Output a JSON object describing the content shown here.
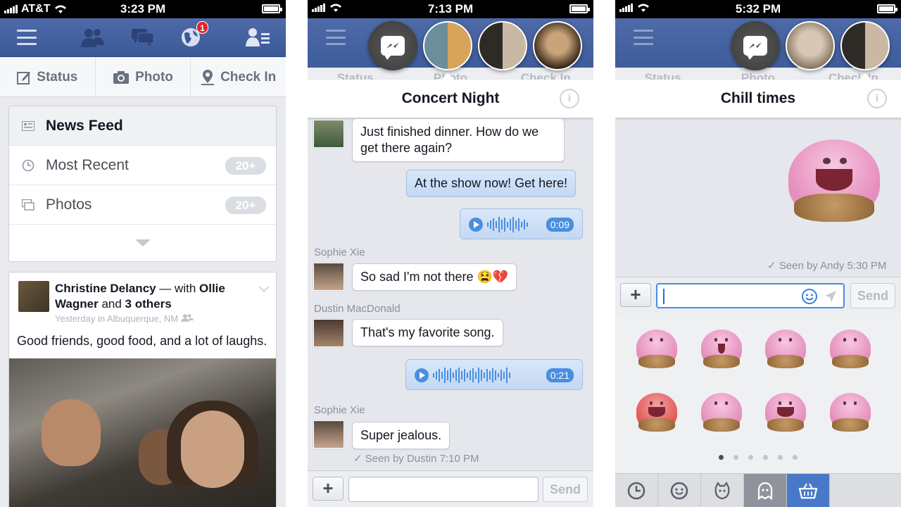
{
  "colors": {
    "brand": "#3b5998",
    "badge": "#e52228",
    "bubble_out": "#c3d8f3",
    "audio": "#4a8ee0"
  },
  "screen1": {
    "status": {
      "carrier": "AT&T",
      "time": "3:23 PM"
    },
    "nav": {
      "icons": [
        "menu-icon",
        "friends-icon",
        "messages-icon",
        "notifications-icon",
        "friend-requests-icon"
      ],
      "notification_count": "1"
    },
    "actions": [
      {
        "label": "Status",
        "icon": "edit-icon"
      },
      {
        "label": "Photo",
        "icon": "camera-icon"
      },
      {
        "label": "Check In",
        "icon": "location-icon"
      }
    ],
    "menu": [
      {
        "label": "News Feed",
        "icon": "feed-icon",
        "count": ""
      },
      {
        "label": "Most Recent",
        "icon": "clock-icon",
        "count": "20+"
      },
      {
        "label": "Photos",
        "icon": "photos-icon",
        "count": "20+"
      }
    ],
    "post": {
      "author": "Christine Delancy",
      "with": " — with ",
      "tag1": "Ollie Wagner",
      "and": " and ",
      "tag2": "3 others",
      "meta": "Yesterday in Albuquerque, NM",
      "text": "Good friends, good food, and a lot of laughs."
    }
  },
  "screen2": {
    "status": {
      "time": "7:13 PM"
    },
    "title": "Concert Night",
    "ghost": {
      "status": "Status",
      "photo": "Photo",
      "checkin": "Check In"
    },
    "messages": [
      {
        "text": "Just finished dinner.  How do we get there again?"
      },
      {
        "text": "At the show now! Get here!"
      },
      {
        "duration": "0:09"
      },
      {
        "sender": "Sophie Xie",
        "text": "So sad I'm not there 😫💔"
      },
      {
        "sender": "Dustin MacDonald",
        "text": "That's my favorite song."
      },
      {
        "duration": "0:21"
      },
      {
        "sender": "Sophie Xie",
        "text": "Super jealous."
      }
    ],
    "seen": "Seen by Dustin 7:10 PM",
    "input": {
      "plus": "+",
      "send": "Send",
      "placeholder": ""
    }
  },
  "screen3": {
    "status": {
      "time": "5:32 PM"
    },
    "title": "Chill times",
    "ghost": {
      "status": "Status",
      "photo": "Photo",
      "checkin": "Check In"
    },
    "seen": "Seen by Andy 5:30 PM",
    "input": {
      "plus": "+",
      "send": "Send"
    },
    "tabs": [
      "clock-icon",
      "smiley-icon",
      "creature-icon",
      "ghost-icon",
      "store-icon"
    ],
    "pager": {
      "pages": 6,
      "current": 1
    }
  }
}
